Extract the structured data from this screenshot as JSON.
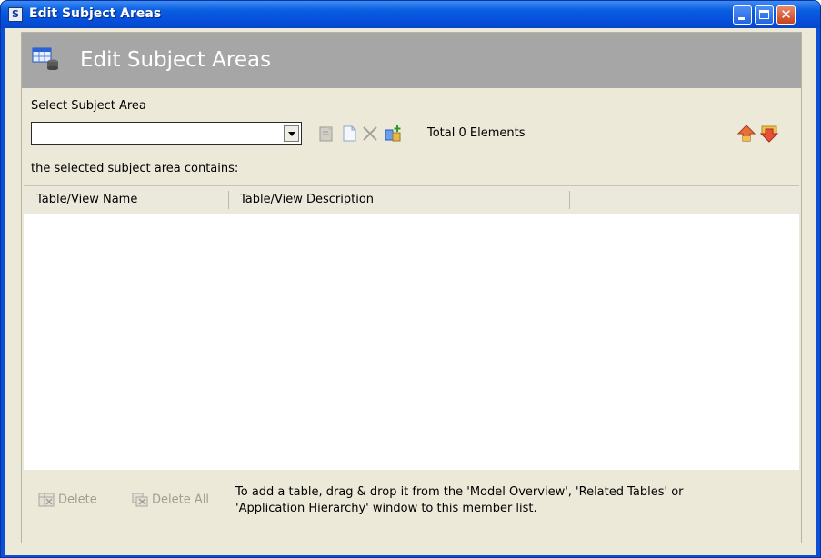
{
  "window": {
    "title": "Edit Subject Areas",
    "app_icon_letter": "S",
    "controls": [
      "minimize",
      "maximize",
      "close"
    ]
  },
  "banner": {
    "title": "Edit Subject Areas",
    "icon": "table-db-icon"
  },
  "selector": {
    "label": "Select Subject Area",
    "value": "",
    "contains_label": "the selected subject area contains:"
  },
  "toolbar": {
    "icons": [
      "edit-icon",
      "new-document-icon",
      "delete-x-icon",
      "add-tables-icon"
    ],
    "total_label": "Total 0 Elements",
    "right_icons": [
      "import-icon",
      "export-icon"
    ]
  },
  "table": {
    "columns": [
      "Table/View Name",
      "Table/View Description"
    ],
    "rows": []
  },
  "footer": {
    "delete_label": "Delete",
    "delete_all_label": "Delete All",
    "hint": "To add a table, drag & drop it from the 'Model Overview', 'Related Tables' or 'Application Hierarchy'  window to this member list."
  },
  "colors": {
    "title_bar": "#0a5ee0",
    "banner": "#a6a6a6",
    "client": "#ece9d8"
  }
}
